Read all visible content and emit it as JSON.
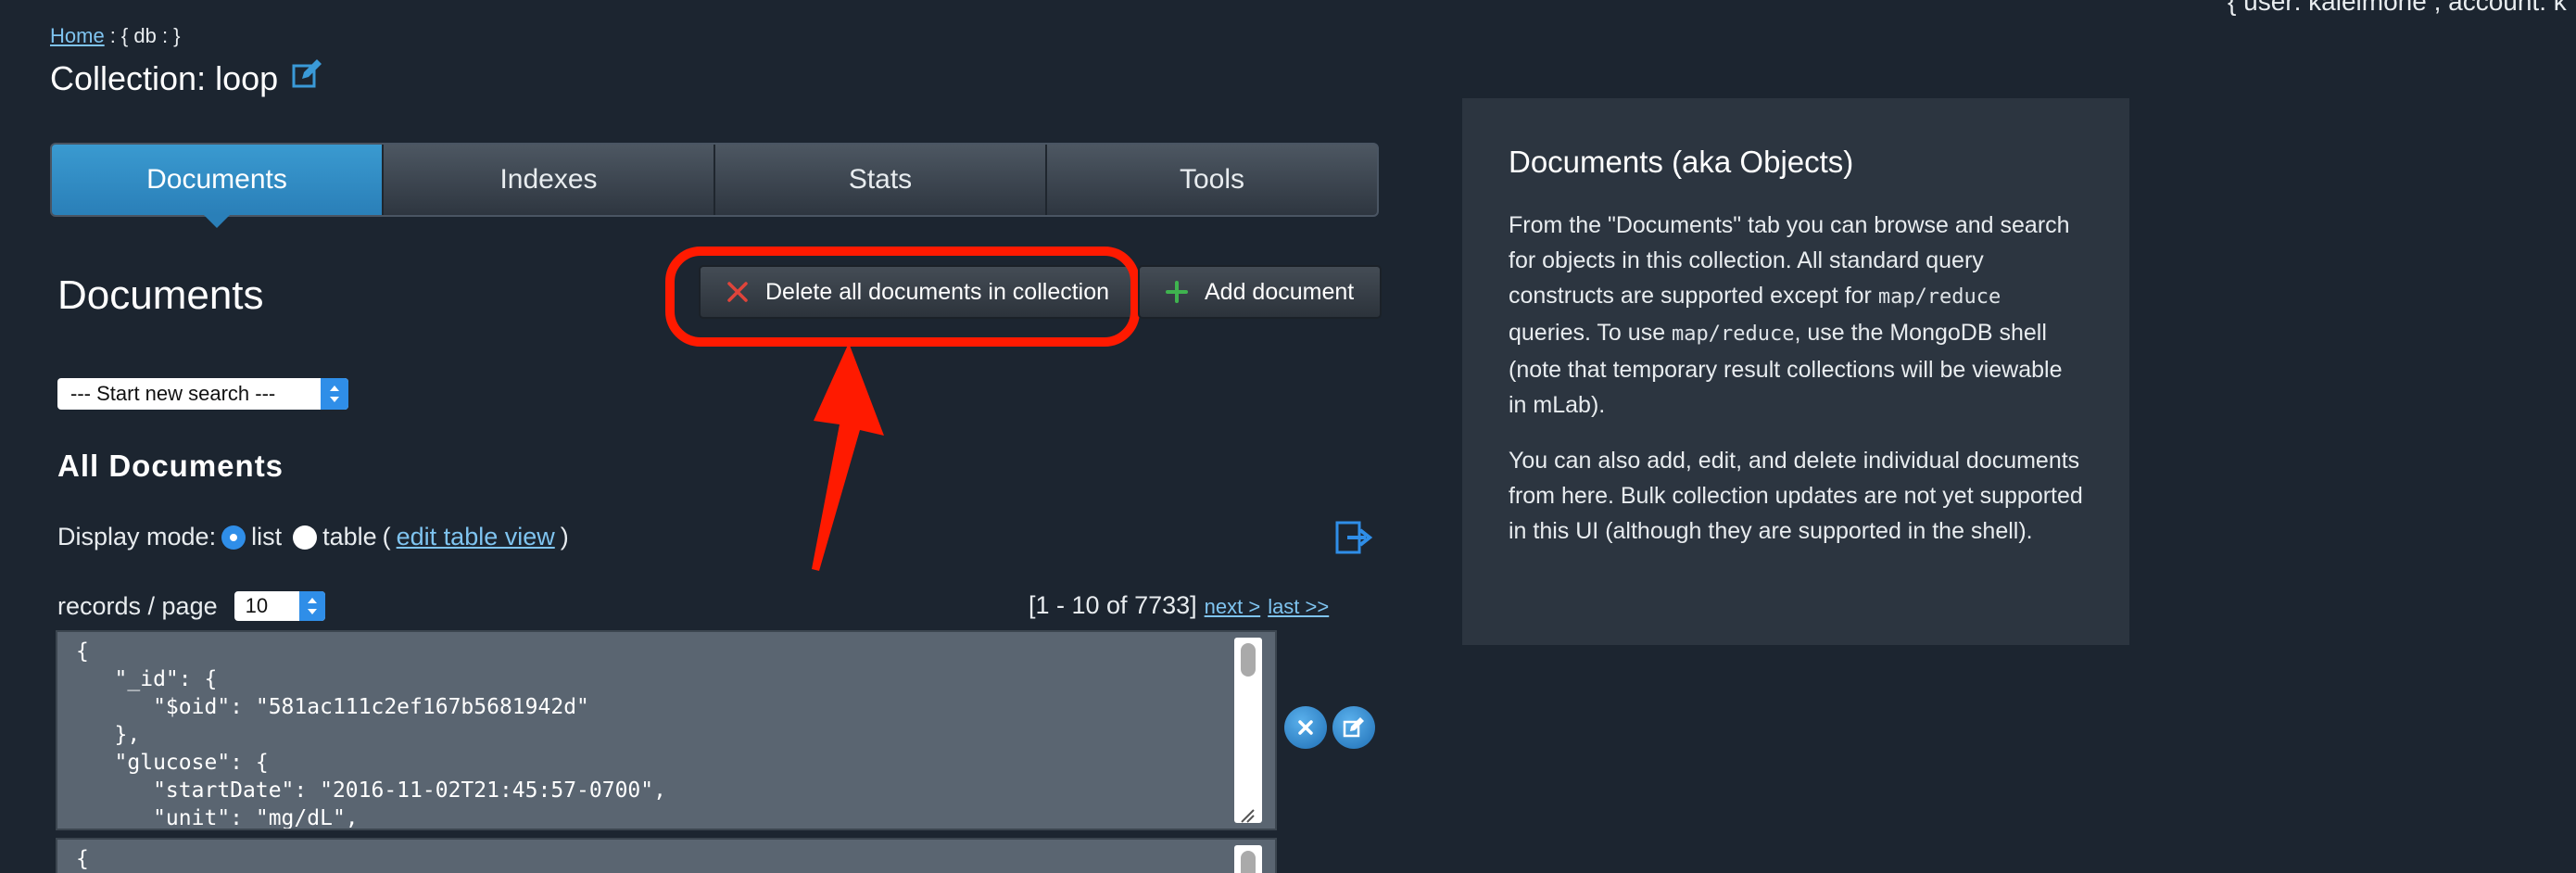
{
  "header": {
    "breadcrumb_home": "Home",
    "breadcrumb_db": ": { db :             }",
    "top_user": "{ user:  kaleimone , account:  k",
    "collection_title": "Collection: loop"
  },
  "tabs": [
    {
      "label": "Documents",
      "active": true
    },
    {
      "label": "Indexes",
      "active": false
    },
    {
      "label": "Stats",
      "active": false
    },
    {
      "label": "Tools",
      "active": false
    }
  ],
  "documents_section": {
    "title": "Documents",
    "delete_all_label": "Delete all documents in collection",
    "add_document_label": "Add document",
    "search_select_value": "--- Start new search ---",
    "all_documents_heading": "All Documents",
    "display_mode_label": "Display mode:",
    "list_option": "list",
    "table_option": "table",
    "edit_table_view_link": "edit table view",
    "records_per_page_label": "records / page",
    "records_per_page_value": "10",
    "pager_range": "[1 - 10 of 7733]",
    "next_link": "next >",
    "last_link": "last >>"
  },
  "docs": [
    {
      "text": "{\n   \"_id\": {\n      \"$oid\": \"581ac111c2ef167b5681942d\"\n   },\n   \"glucose\": {\n      \"startDate\": \"2016-11-02T21:45:57-0700\",\n      \"unit\": \"mg/dL\","
    },
    {
      "text": "{\n   \"_id\": {"
    }
  ],
  "info_panel": {
    "title": "Documents (aka Objects)",
    "p1_a": "From the \"Documents\" tab you can browse and search for objects in this collection. All standard query constructs are supported except for ",
    "p1_code1": "map/reduce",
    "p1_b": " queries. To use ",
    "p1_code2": "map/reduce",
    "p1_c": ", use the MongoDB shell (note that temporary result collections will be viewable in mLab).",
    "p2": "You can also add, edit, and delete individual documents from here. Bulk collection updates are not yet supported in this UI (although they are supported in the shell)."
  },
  "colors": {
    "background": "#1c2530",
    "accent_blue": "#2a7fb8",
    "highlight_red": "#ff1a00",
    "link": "#7fc4f0"
  },
  "icons": [
    "edit-icon",
    "delete-x-icon",
    "plus-icon",
    "export-icon",
    "remove-circle-icon",
    "edit-circle-icon",
    "annotation-arrow"
  ]
}
